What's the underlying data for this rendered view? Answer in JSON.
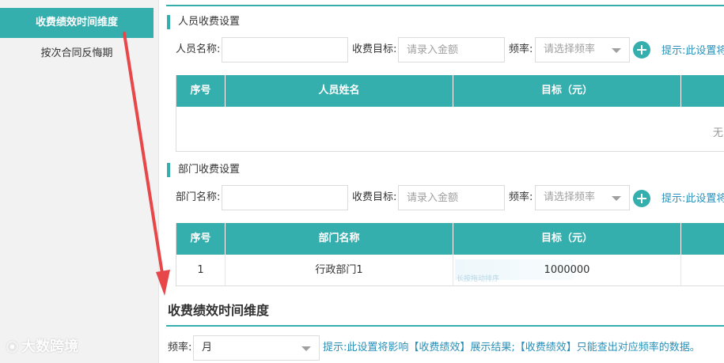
{
  "sidebar": {
    "items": [
      {
        "label": "收费绩效时间维度",
        "active": true
      },
      {
        "label": "按次合同反悔期",
        "active": false
      }
    ],
    "watermark": "大数跨境"
  },
  "person_section": {
    "title": "人员收费设置",
    "name_label": "人员名称:",
    "name_value": "",
    "target_label": "收费目标:",
    "target_placeholder": "请录入金额",
    "freq_label": "频率:",
    "freq_placeholder": "请选择频率",
    "hint": "提示:此设置将",
    "table": {
      "columns": [
        "序号",
        "人员姓名",
        "目标（元）",
        ""
      ],
      "empty_text": "无"
    }
  },
  "dept_section": {
    "title": "部门收费设置",
    "name_label": "部门名称:",
    "name_value": "",
    "target_label": "收费目标:",
    "target_placeholder": "请录入金额",
    "freq_label": "频率:",
    "freq_placeholder": "请选择频率",
    "hint": "提示:此设置将",
    "table": {
      "columns": [
        "序号",
        "部门名称",
        "目标（元）",
        ""
      ],
      "rows": [
        {
          "index": "1",
          "name": "行政部门1",
          "target": "1000000",
          "drag_hint": "长按拖动排序"
        }
      ]
    }
  },
  "time_section": {
    "title": "收费绩效时间维度",
    "freq_label": "频率:",
    "freq_value": "月",
    "hint": "提示:此设置将影响【收费绩效】展示结果;【收费绩效】只能查出对应频率的数据。"
  },
  "colors": {
    "accent": "#35aeae",
    "hint": "#2a90b8",
    "annotation": "#e8474a"
  }
}
